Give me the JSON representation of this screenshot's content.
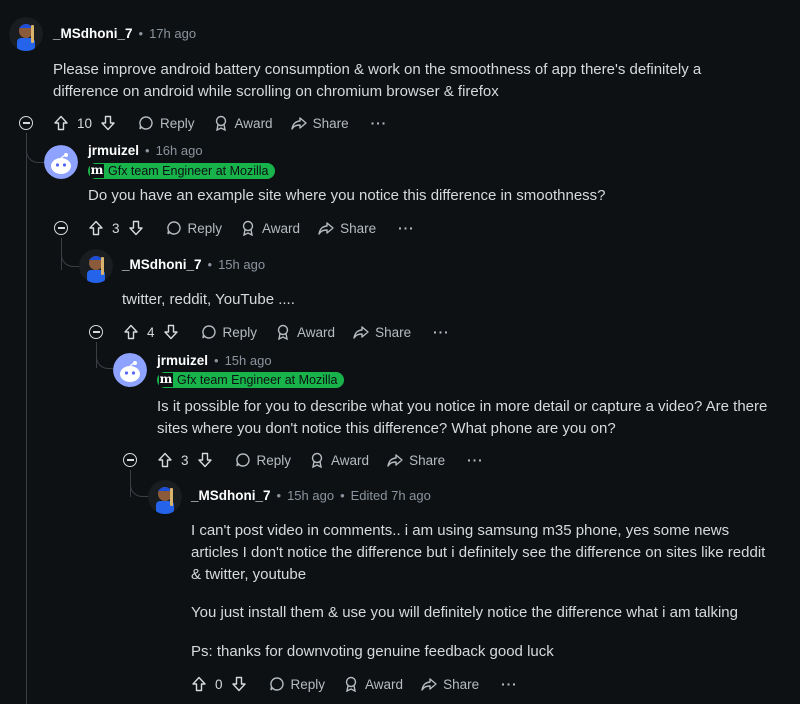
{
  "comments": [
    {
      "user": "_MSdhoni_7",
      "time": "17h ago",
      "edited": "",
      "flair": "",
      "body": "Please improve android battery consumption & work on the smoothness of app there's definitely a difference on android while scrolling on chromium browser & firefox",
      "score": "10"
    },
    {
      "user": "jrmuizel",
      "time": "16h ago",
      "edited": "",
      "flair": "Gfx team Engineer at Mozilla",
      "body": "Do you have an example site where you notice this difference in smoothness?",
      "score": "3"
    },
    {
      "user": "_MSdhoni_7",
      "time": "15h ago",
      "edited": "",
      "flair": "",
      "body": "twitter, reddit, YouTube ....",
      "score": "4"
    },
    {
      "user": "jrmuizel",
      "time": "15h ago",
      "edited": "",
      "flair": "Gfx team Engineer at Mozilla",
      "body": "Is it possible for you to describe what you notice in more detail or capture a video? Are there sites where you don't notice this difference? What phone are you on?",
      "score": "3"
    },
    {
      "user": "_MSdhoni_7",
      "time": "15h ago",
      "edited": "Edited 7h ago",
      "flair": "",
      "body_paragraphs": [
        "I can't post video in comments.. i am using samsung m35 phone, yes some news articles I don't notice the difference but i definitely see the difference on sites like reddit & twitter, youtube",
        "You just install them & use you will definitely notice the difference what i am talking",
        "Ps: thanks for downvoting genuine feedback good luck"
      ],
      "score": "0"
    }
  ],
  "labels": {
    "reply": "Reply",
    "award": "Award",
    "share": "Share",
    "more": "···",
    "flair_logo": "m",
    "separator": "•"
  },
  "icons": {
    "collapse": "minus-circle-icon",
    "upvote": "arrow-up-icon",
    "downvote": "arrow-down-icon",
    "reply": "speech-bubble-icon",
    "award": "award-icon",
    "share": "share-arrow-icon"
  },
  "colors": {
    "background": "#0e1113",
    "flair": "#18b34b",
    "thread_line": "#3a3f44",
    "muted_text": "#8b949e"
  }
}
